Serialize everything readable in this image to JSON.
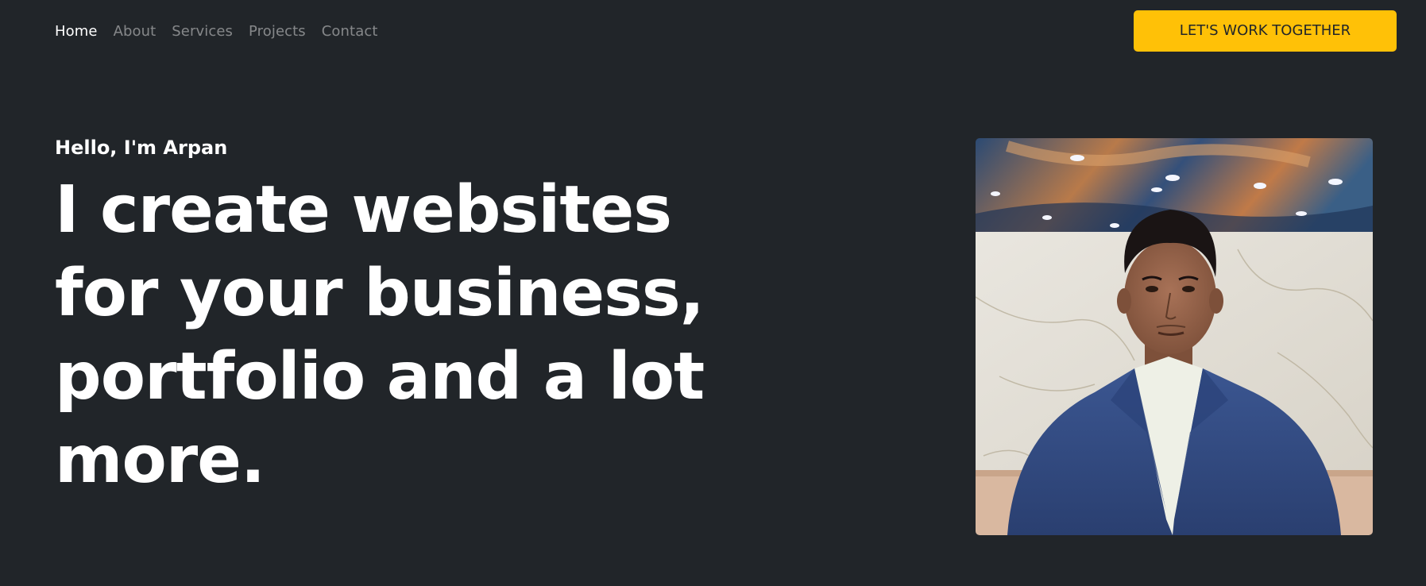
{
  "nav": {
    "links": [
      {
        "label": "Home",
        "active": true
      },
      {
        "label": "About",
        "active": false
      },
      {
        "label": "Services",
        "active": false
      },
      {
        "label": "Projects",
        "active": false
      },
      {
        "label": "Contact",
        "active": false
      }
    ],
    "cta_label": "LET'S WORK TOGETHER"
  },
  "hero": {
    "greeting": "Hello, I'm Arpan",
    "headline": "I create websites for your business, portfolio and a lot more."
  },
  "colors": {
    "background": "#212529",
    "accent": "#ffc107",
    "text": "#ffffff",
    "muted_text": "rgba(255,255,255,0.45)"
  }
}
